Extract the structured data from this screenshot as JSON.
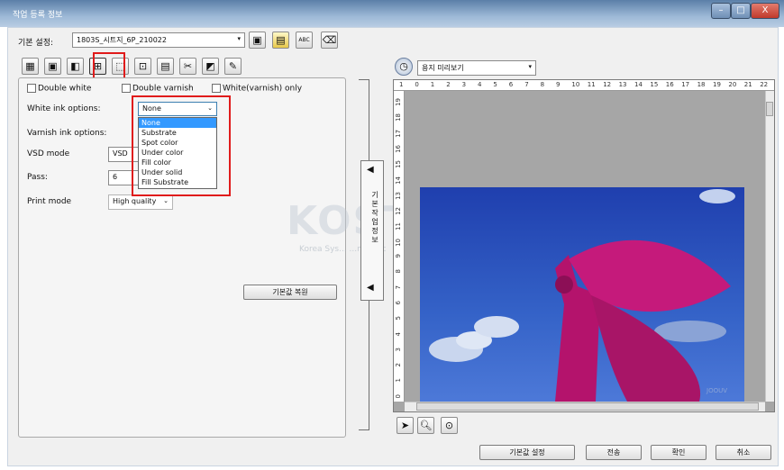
{
  "window": {
    "title": "작업 등록 정보",
    "min": "–",
    "max": "□",
    "close": "X"
  },
  "preset": {
    "label": "기본 설정:",
    "value": "1803S_시트지_6P_210022"
  },
  "toolbar_icons": [
    "save-icon",
    "save-as-icon",
    "rename-icon",
    "delete-icon"
  ],
  "tabs": [
    {
      "name": "tab-media",
      "icon": "▦"
    },
    {
      "name": "tab-image",
      "icon": "▣"
    },
    {
      "name": "tab-layout",
      "icon": "◧"
    },
    {
      "name": "tab-print-options",
      "icon": "⊞",
      "selected": true
    },
    {
      "name": "tab-crop",
      "icon": "⬚"
    },
    {
      "name": "tab-position",
      "icon": "⊡"
    },
    {
      "name": "tab-color",
      "icon": "▤"
    },
    {
      "name": "tab-cut",
      "icon": "✂"
    },
    {
      "name": "tab-ink",
      "icon": "◩"
    },
    {
      "name": "tab-finish",
      "icon": "✎"
    }
  ],
  "options": {
    "double_white": "Double white",
    "double_varnish": "Double varnish",
    "white_varnish_only": "White(varnish) only",
    "white_ink_label": "White ink options:",
    "white_ink_value": "None",
    "white_ink_list": [
      "None",
      "Substrate",
      "Spot color",
      "Under color",
      "Fill color",
      "Under solid",
      "Fill Substrate"
    ],
    "varnish_label": "Varnish ink options:",
    "vsd_label": "VSD mode",
    "vsd_value": "VSD",
    "pass_label": "Pass:",
    "pass_value": "6",
    "print_mode_label": "Print mode",
    "print_mode_value": "High quality",
    "reset_button": "기본값 복원"
  },
  "collapse": {
    "text": "기본 작업 정보",
    "arrow": "◀"
  },
  "preview": {
    "mode_value": "용지 미리보기",
    "ruler_top": [
      "1",
      "0",
      "1",
      "2",
      "3",
      "4",
      "5",
      "6",
      "7",
      "8",
      "9",
      "10",
      "11",
      "12",
      "13",
      "14",
      "15",
      "16",
      "17",
      "18",
      "19",
      "20",
      "21",
      "22"
    ],
    "ruler_left": [
      "19",
      "18",
      "17",
      "16",
      "15",
      "14",
      "13",
      "12",
      "11",
      "10",
      "9",
      "8",
      "7",
      "6",
      "5",
      "4",
      "3",
      "2",
      "1",
      "0"
    ],
    "watermark": "KOSTT",
    "watermark_sub": "Korea Sys... ...ngs Inc",
    "photo_mark": "JOOUV"
  },
  "footer": {
    "defaults": "기본값 설정",
    "send": "전송",
    "ok": "확인",
    "cancel": "취소"
  }
}
